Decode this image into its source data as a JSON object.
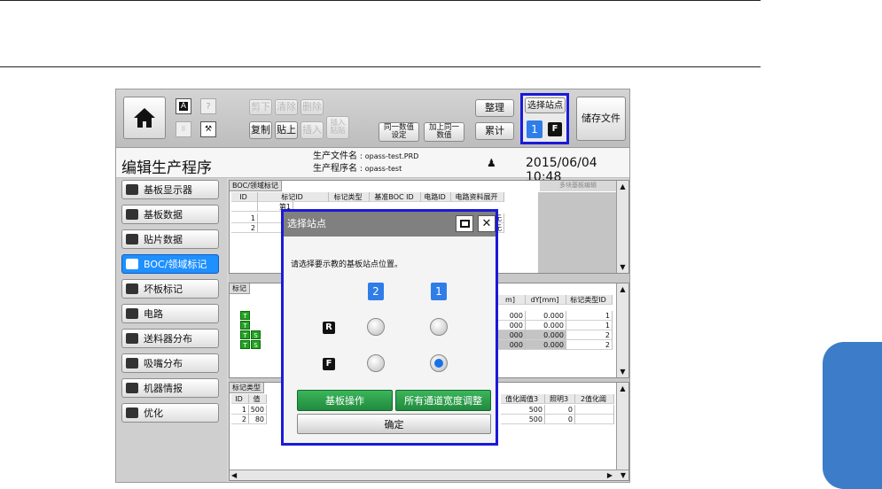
{
  "toolbar": {
    "btn_a": "A",
    "btn_help": "?",
    "cut": "剪下",
    "clear": "清除",
    "delete": "删除",
    "copy": "复制",
    "paste": "贴上",
    "insert": "插入",
    "insert_paste": "插入\n贴贴",
    "same_value_set": "同一数值\n设定",
    "add_same_value": "加上同一\n数值",
    "organize": "整理",
    "accumulate": "累计",
    "select_station": "选择站点",
    "station_num": "1",
    "station_letter": "F",
    "save_file": "储存文件"
  },
  "header": {
    "page_title": "编辑生产程序",
    "file_name_label": "生产文件名",
    "file_name": "opass-test.PRD",
    "program_name_label": "生产程序名",
    "program_name": "opass-test",
    "datetime": "2015/06/04 10:48"
  },
  "sidebar": {
    "items": [
      {
        "label": "基板显示器"
      },
      {
        "label": "基板数据"
      },
      {
        "label": "贴片数据"
      },
      {
        "label": "BOC/领域标记"
      },
      {
        "label": "坏板标记"
      },
      {
        "label": "电路"
      },
      {
        "label": "送料器分布"
      },
      {
        "label": "吸嘴分布"
      },
      {
        "label": "机器情报"
      },
      {
        "label": "优化"
      }
    ]
  },
  "boc_section": {
    "title": "BOC/领域标记",
    "right_label": "多块基板编辑",
    "headers": [
      "ID",
      "标记ID",
      "标记类型",
      "基准BOC ID",
      "电路ID",
      "电路资料展开"
    ],
    "sub_header": "第1",
    "rows": [
      {
        "id": "1",
        "expand": "无"
      },
      {
        "id": "2",
        "expand": "无"
      }
    ]
  },
  "mark_section": {
    "title": "标记",
    "headers": [
      "m]",
      "dY[mm]",
      "标记类型ID"
    ],
    "rows": [
      {
        "btns": [
          "T"
        ],
        "dx": "000",
        "dy": "0.000",
        "type": "1"
      },
      {
        "btns": [
          "T"
        ],
        "dx": "000",
        "dy": "0.000",
        "type": "1"
      },
      {
        "btns": [
          "T",
          "S"
        ],
        "dx": "000",
        "dy": "0.000",
        "type": "2"
      },
      {
        "btns": [
          "T",
          "S"
        ],
        "dx": "000",
        "dy": "0.000",
        "type": "2"
      }
    ]
  },
  "mark_type_section": {
    "title": "标记类型",
    "headers": [
      "ID",
      "值",
      "值化阈值3",
      "照明3",
      "2值化阈"
    ],
    "rows": [
      {
        "id": "1",
        "v": "500",
        "t": "500",
        "l": "0"
      },
      {
        "id": "2",
        "v": "80",
        "t": "500",
        "l": "0"
      }
    ]
  },
  "modal": {
    "title": "选择站点",
    "instruction": "请选择要示教的基板站点位置。",
    "col_left": "2",
    "col_right": "1",
    "row_r": "R",
    "row_f": "F",
    "selected": "F-1",
    "board_operation": "基板操作",
    "all_width_adjust": "所有通道宽度调整",
    "ok": "确定"
  },
  "colors": {
    "highlight_border": "#1a1ad8",
    "accent_blue": "#2f7de8",
    "green_button": "#2a9c4a",
    "side_tab": "#3d7cc9"
  }
}
